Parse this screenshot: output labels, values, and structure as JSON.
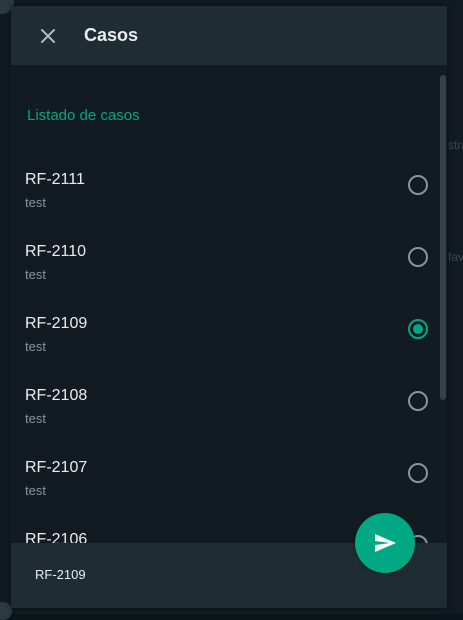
{
  "dialog": {
    "title": "Casos",
    "close_icon": "close-icon"
  },
  "list": {
    "section_title": "Listado de casos",
    "items": [
      {
        "id": "RF-2111",
        "desc": "test",
        "selected": false
      },
      {
        "id": "RF-2110",
        "desc": "test",
        "selected": false
      },
      {
        "id": "RF-2109",
        "desc": "test",
        "selected": true
      },
      {
        "id": "RF-2108",
        "desc": "test",
        "selected": false
      },
      {
        "id": "RF-2107",
        "desc": "test",
        "selected": false
      },
      {
        "id": "RF-2106",
        "desc": "",
        "selected": false
      }
    ]
  },
  "footer": {
    "selected_case": "RF-2109"
  },
  "send_button": {
    "icon": "send-icon"
  },
  "background": {
    "partial_text_1": "stra",
    "partial_text_2": "fav"
  },
  "colors": {
    "accent": "#00a884",
    "header_bg": "#202c33",
    "panel_bg": "#111b21",
    "text_primary": "#e9edef",
    "text_secondary": "#8696a0"
  }
}
